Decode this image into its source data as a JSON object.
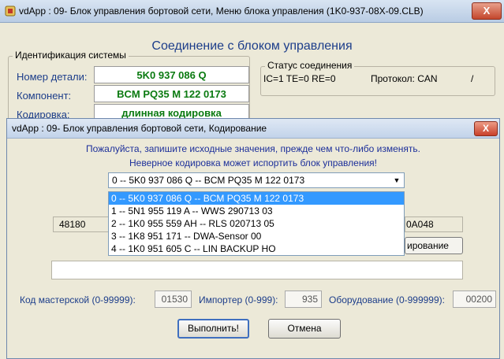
{
  "background_window": {
    "title": "vdApp : 09- Блок управления бортовой сети,  Меню блока управления (1K0-937-08X-09.CLB)",
    "close_label": "X",
    "heading": "Соединение с блоком управления",
    "identification": {
      "group_label": "Идентификация системы",
      "part_number_label": "Номер детали:",
      "part_number_value": "5K0 937 086 Q",
      "component_label": "Компонент:",
      "component_value": "BCM PQ35 M    122 0173",
      "coding_label": "Кодировка:",
      "coding_value": "длинная кодировка"
    },
    "connection_status": {
      "group_label": "Статус соединения",
      "status_text": "IC=1  TE=0   RE=0",
      "protocol_text": "Протокол: CAN",
      "slash": "/"
    }
  },
  "dialog": {
    "title": "vdApp : 09- Блок управления бортовой сети,  Кодирование",
    "close_label": "X",
    "instruction_1": "Пожалуйста, запишите исходные значения, прежде чем что-либо изменять.",
    "instruction_2": "Неверное кодировка может испортить блок управления!",
    "combo": {
      "selected": "0 -- 5K0 937 086 Q -- BCM PQ35 M     122 0173",
      "options": [
        "0 -- 5K0 937 086 Q -- BCM PQ35 M     122 0173",
        "1 -- 5N1 955 119 A -- WWS 290713 03",
        "2 -- 1K0 955 559 AH -- RLS 020713 05",
        "3 -- 1K8 951 171   -- DWA-Sensor 00",
        "4 -- 1K0 951 605 C -- LIN BACKUP HO"
      ]
    },
    "partial_left_value": "48180",
    "partial_right_value": "0A048",
    "coding_button_partial": "ирование",
    "workshop_code_label": "Код мастерской (0-99999):",
    "workshop_code_value": "01530",
    "importer_label": "Импортер (0-999):",
    "importer_value": "935",
    "equipment_label": "Оборудование (0-999999):",
    "equipment_value": "00200",
    "execute_button": "Выполнить!",
    "cancel_button": "Отмена"
  },
  "colors": {
    "accent_blue": "#1c3d8a",
    "value_green": "#0a7a10",
    "selection_blue": "#3399ff",
    "close_red": "#c9402a"
  }
}
